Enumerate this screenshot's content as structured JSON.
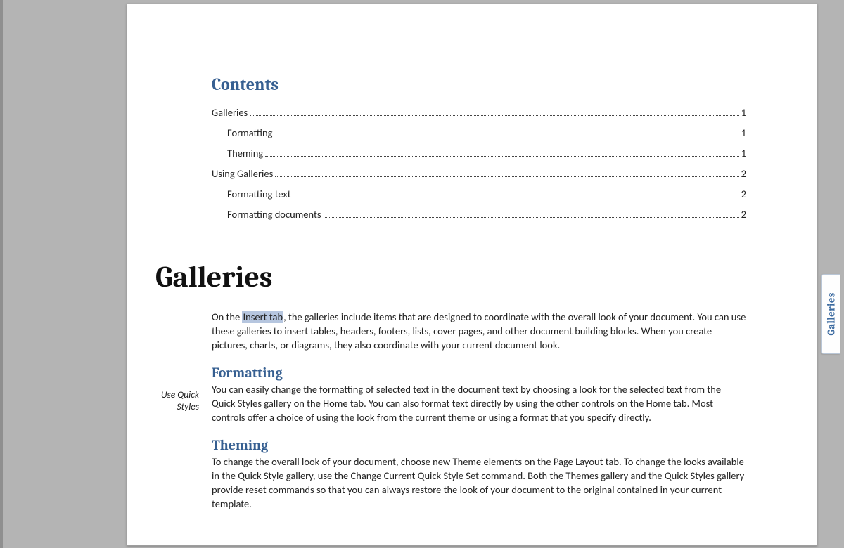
{
  "toc": {
    "title": "Contents",
    "entries": [
      {
        "label": "Galleries",
        "page": "1",
        "level": 1
      },
      {
        "label": "Formatting",
        "page": "1",
        "level": 2
      },
      {
        "label": "Theming",
        "page": "1",
        "level": 2
      },
      {
        "label": "Using Galleries",
        "page": "2",
        "level": 1
      },
      {
        "label": "Formatting text",
        "page": "2",
        "level": 2
      },
      {
        "label": "Formatting documents",
        "page": "2",
        "level": 2
      }
    ]
  },
  "doc": {
    "heading1": "Galleries",
    "intro_before": "On the ",
    "intro_highlight": "Insert tab",
    "intro_after": ", the galleries include items that are designed to coordinate with the overall look of your document. You can use these galleries to insert tables, headers, footers, lists, cover pages, and other document building blocks. When you create pictures, charts, or diagrams, they also coordinate with your current document look.",
    "formatting_heading": "Formatting",
    "formatting_body": "You can easily change the formatting of selected text in the document text by choosing a look for the selected text from the Quick Styles gallery on the Home tab. You can also format text directly by using the other controls on the Home tab. Most controls offer a choice of using the look from the current theme or using a format that you specify directly.",
    "theming_heading": "Theming",
    "theming_body": "To change the overall look of your document, choose new Theme elements on the Page Layout tab. To change the looks available in the Quick Style gallery, use the Change Current Quick Style Set command. Both the Themes gallery and the Quick Styles gallery provide reset commands so that you can always restore the look of your document to the original contained in your current template.",
    "margin_note": "Use Quick Styles"
  },
  "side_tab": {
    "label": "Galleries"
  }
}
